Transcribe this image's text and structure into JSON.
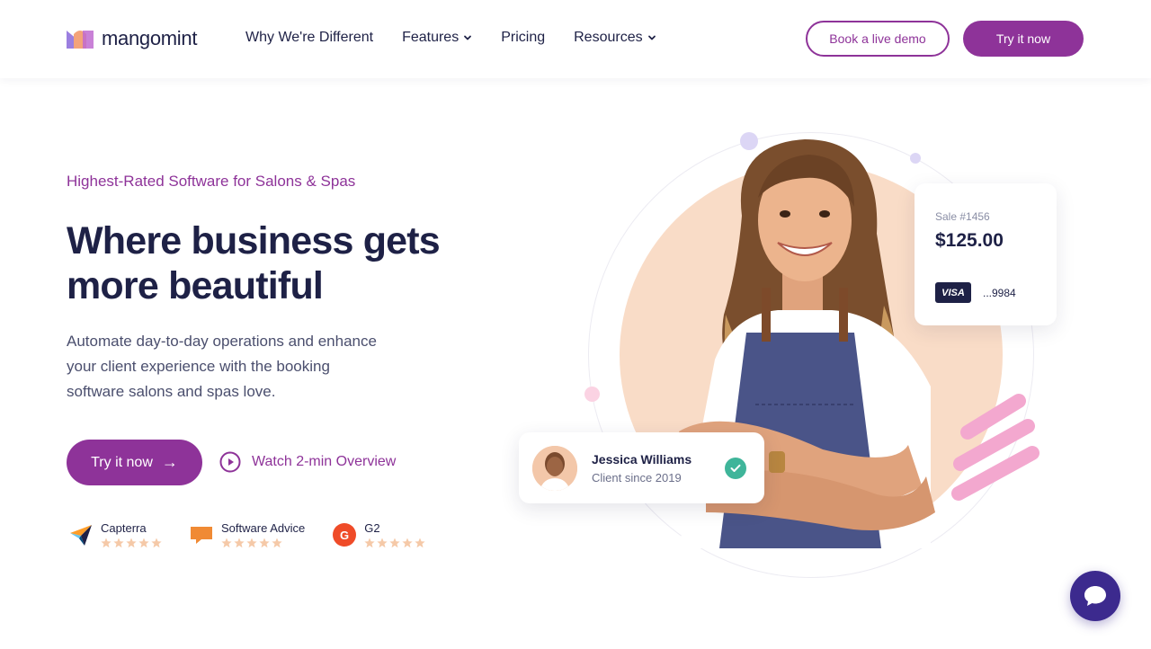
{
  "brand": {
    "name": "mangomint",
    "accent": "#8e3399",
    "navy": "#1e2146"
  },
  "nav": {
    "items": [
      {
        "label": "Why We're Different",
        "has_dropdown": false
      },
      {
        "label": "Features",
        "has_dropdown": true
      },
      {
        "label": "Pricing",
        "has_dropdown": false
      },
      {
        "label": "Resources",
        "has_dropdown": true
      }
    ],
    "demo_label": "Book a live demo",
    "try_label": "Try it now"
  },
  "hero": {
    "eyebrow": "Highest-Rated Software for Salons & Spas",
    "headline_line1": "Where business gets",
    "headline_line2": "more beautiful",
    "subtext": "Automate day-to-day operations and enhance your client experience with the booking software salons and spas love.",
    "cta_label": "Try it now",
    "cta_arrow": "→",
    "watch_label": "Watch 2-min Overview"
  },
  "ratings": [
    {
      "name": "Capterra",
      "icon": "capterra-icon",
      "stars": 5
    },
    {
      "name": "Software Advice",
      "icon": "software-advice-icon",
      "stars": 5
    },
    {
      "name": "G2",
      "icon": "g2-icon",
      "stars": 5
    }
  ],
  "sale_card": {
    "label": "Sale #1456",
    "amount": "$125.00",
    "card_brand": "VISA",
    "last_digits": "...9984"
  },
  "client_card": {
    "name": "Jessica Williams",
    "since": "Client since 2019"
  },
  "chat": {
    "icon": "chat-bubble-icon"
  }
}
